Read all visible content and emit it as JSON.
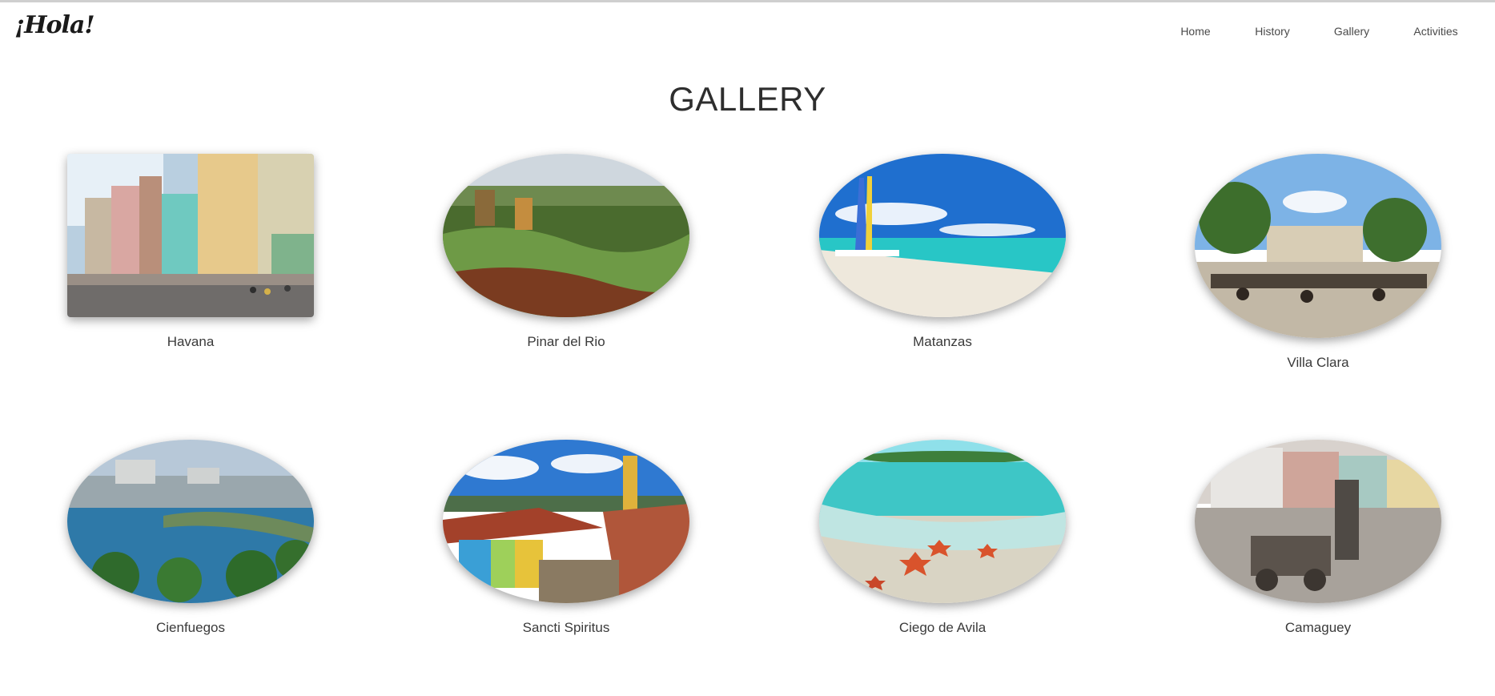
{
  "header": {
    "logo_text": "¡Hola!",
    "nav": [
      "Home",
      "History",
      "Gallery",
      "Activities"
    ]
  },
  "page_title": "GALLERY",
  "gallery": [
    {
      "caption": "Havana",
      "image": "colorful-colonial-street"
    },
    {
      "caption": "Pinar del Rio",
      "image": "tobacco-field-farmers"
    },
    {
      "caption": "Matanzas",
      "image": "beach-with-sailboats"
    },
    {
      "caption": "Villa Clara",
      "image": "square-with-horse-carriages"
    },
    {
      "caption": "Cienfuegos",
      "image": "bay-with-palms-and-city"
    },
    {
      "caption": "Sancti Spiritus",
      "image": "colonial-rooftops-and-tower"
    },
    {
      "caption": "Ciego de Avila",
      "image": "shallow-water-starfish"
    },
    {
      "caption": "Camaguey",
      "image": "street-with-statue-and-cart"
    }
  ]
}
